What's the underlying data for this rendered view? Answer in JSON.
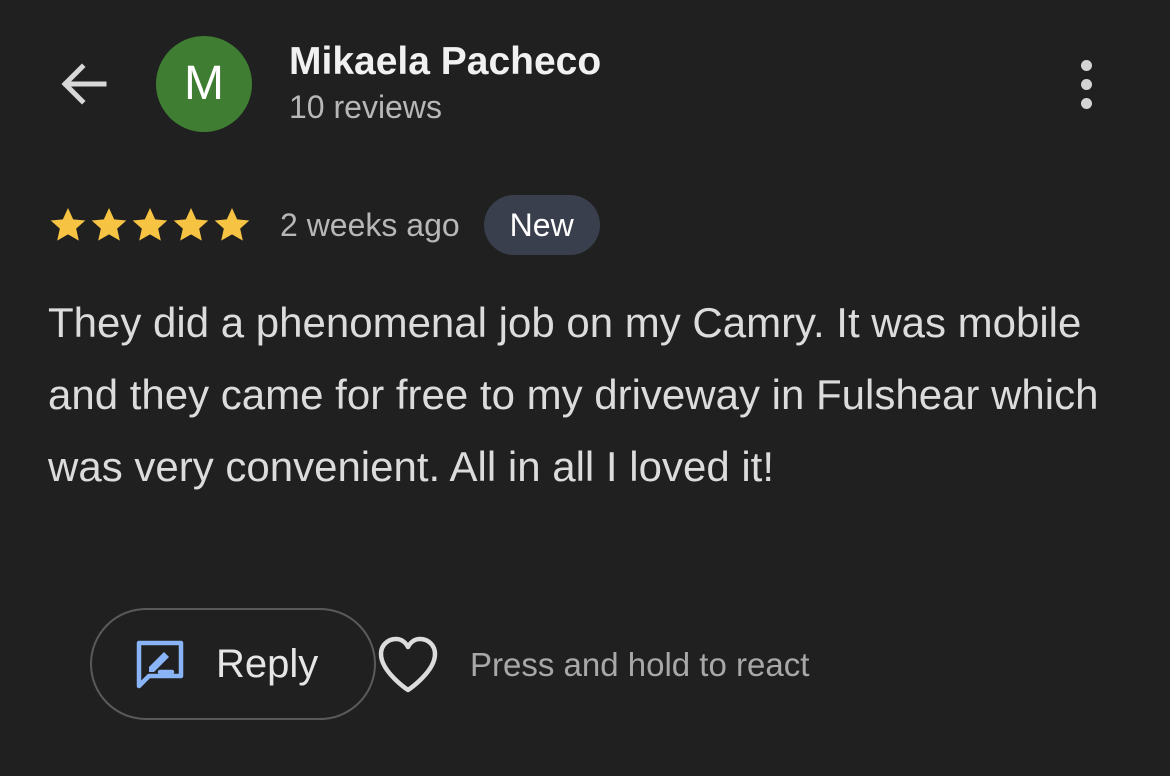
{
  "header": {
    "back_icon": "arrow-left-icon",
    "avatar_initial": "M",
    "avatar_color": "#3f7e32",
    "user_name": "Mikaela Pacheco",
    "review_count": "10 reviews",
    "more_icon": "more-vertical-icon"
  },
  "review": {
    "rating": 5,
    "rating_max": 5,
    "star_color": "#f6c343",
    "time_ago": "2 weeks ago",
    "badge": "New",
    "text": "They did a phenomenal job on my Camry. It was mobile and they came for free to my driveway in Fulshear which was very convenient. All in all I loved it!"
  },
  "actions": {
    "reply_icon": "reply-edit-icon",
    "reply_label": "Reply",
    "react_icon": "heart-outline-icon",
    "react_hint": "Press and hold to react"
  },
  "colors": {
    "background": "#202020",
    "accent": "#8ab4f8"
  }
}
